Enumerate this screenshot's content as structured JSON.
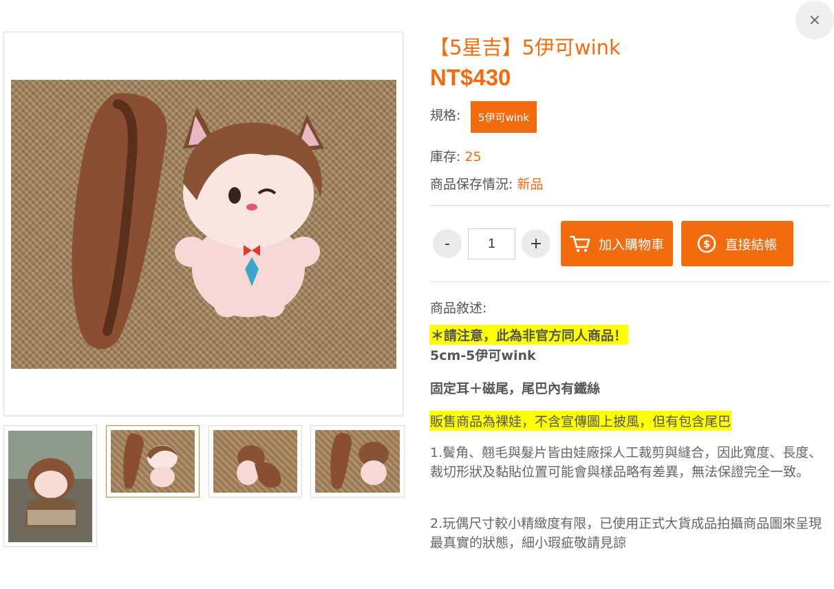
{
  "close": {
    "symbol": "×"
  },
  "product": {
    "title": "【5星吉】5伊可wink",
    "price": "NT$430",
    "spec_label": "規格:",
    "spec_option": "5伊可wink",
    "stock_label": "庫存: ",
    "stock_value": "25",
    "condition_label": "商品保存情況: ",
    "condition_value": "新品"
  },
  "purchase": {
    "minus": "-",
    "plus": "+",
    "quantity": "1",
    "add_to_cart": "加入購物車",
    "checkout": "直接結帳"
  },
  "description": {
    "label": "商品敘述:",
    "warning": "＊請注意，此為非官方同人商品！",
    "size": "5cm-5伊可wink",
    "features": "固定耳＋磁尾，尾巴內有鐵絲",
    "note": "販售商品為裸娃，不含宣傳圖上披風，但有包含尾巴",
    "para1": "1.鬢角、翹毛與髮片皆由娃廠採人工裁剪與縫合，因此寬度、長度、裁切形狀及黏貼位置可能會與樣品略有差異，無法保證完全一致。",
    "para2": "2.玩偶尺寸較小精緻度有限，已使用正式大貨成品拍攝商品圖來呈現最真實的狀態，細小瑕疵敬請見諒"
  },
  "colors": {
    "accent": "#f26b0f",
    "highlight": "#ffff00"
  },
  "gallery": {
    "main_image": "plush-with-tail-photo",
    "thumbnails": [
      "plush-with-coat-photo",
      "plush-with-tail-photo",
      "plush-back-photo",
      "plush-and-tail-photo"
    ],
    "active_thumbnail": 1
  }
}
